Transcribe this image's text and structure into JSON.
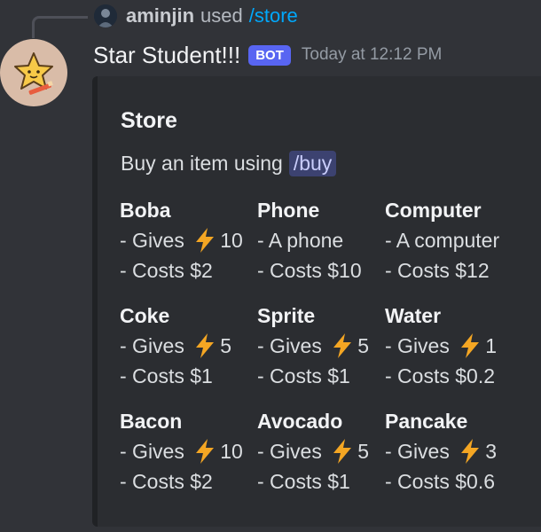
{
  "reply": {
    "username": "aminjin",
    "used_text": "used",
    "command": "/store"
  },
  "message": {
    "bot_name": "Star Student!!!",
    "bot_tag": "BOT",
    "timestamp": "Today at 12:12 PM"
  },
  "embed": {
    "title": "Store",
    "description_prefix": "Buy an item using",
    "description_command": "/buy",
    "fields": [
      {
        "name": "Boba",
        "line1_prefix": "- Gives ",
        "line1_bolt": true,
        "line1_value": "10",
        "line2": "- Costs $2"
      },
      {
        "name": "Phone",
        "line1_prefix": "- A phone",
        "line1_bolt": false,
        "line1_value": "",
        "line2": "- Costs $10"
      },
      {
        "name": "Computer",
        "line1_prefix": "- A computer",
        "line1_bolt": false,
        "line1_value": "",
        "line2": "- Costs $12"
      },
      {
        "name": "Coke",
        "line1_prefix": "- Gives ",
        "line1_bolt": true,
        "line1_value": "5",
        "line2": "- Costs $1"
      },
      {
        "name": "Sprite",
        "line1_prefix": "- Gives ",
        "line1_bolt": true,
        "line1_value": "5",
        "line2": "- Costs $1"
      },
      {
        "name": "Water",
        "line1_prefix": "- Gives ",
        "line1_bolt": true,
        "line1_value": "1",
        "line2": "- Costs $0.2"
      },
      {
        "name": "Bacon",
        "line1_prefix": "- Gives ",
        "line1_bolt": true,
        "line1_value": "10",
        "line2": "- Costs $2"
      },
      {
        "name": "Avocado",
        "line1_prefix": "- Gives ",
        "line1_bolt": true,
        "line1_value": "5",
        "line2": "- Costs $1"
      },
      {
        "name": "Pancake",
        "line1_prefix": "- Gives ",
        "line1_bolt": true,
        "line1_value": "3",
        "line2": "- Costs $0.6"
      }
    ]
  },
  "icons": {
    "bolt": "lightning-bolt-emoji",
    "bot_avatar": "star-with-pencil-icon",
    "user_avatar": "user-avatar-icon"
  },
  "colors": {
    "bot_tag": "#5865f2",
    "command_link": "#00a8fc",
    "bolt": "#f4a623"
  }
}
